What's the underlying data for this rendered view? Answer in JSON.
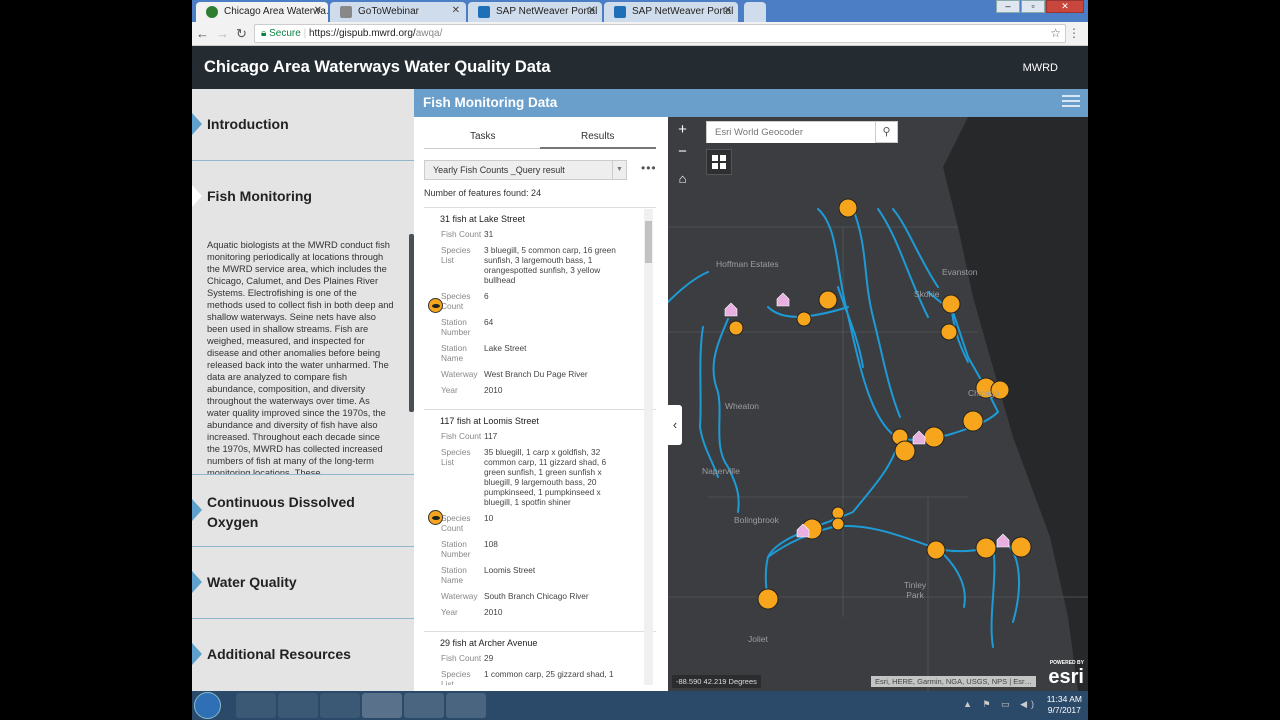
{
  "browser": {
    "tabs": [
      {
        "title": "Chicago Area Waterwa…",
        "active": true,
        "icon": "globe-icon"
      },
      {
        "title": "GoToWebinar",
        "active": false,
        "icon": "webinar-icon"
      },
      {
        "title": "SAP NetWeaver Portal",
        "active": false,
        "icon": "sap-icon"
      },
      {
        "title": "SAP NetWeaver Portal",
        "active": false,
        "icon": "sap-icon"
      }
    ],
    "secure_label": "Secure",
    "url_host": "https://gispub.mwrd.org/",
    "url_path": "awqa/"
  },
  "app": {
    "title": "Chicago Area Waterways Water Quality Data",
    "org": "MWRD"
  },
  "nav": {
    "items": [
      {
        "label": "Introduction"
      },
      {
        "label": "Fish Monitoring"
      },
      {
        "label": "Continuous Dissolved\nOxygen"
      },
      {
        "label": "Water Quality"
      },
      {
        "label": "Additional Resources"
      }
    ],
    "fish_text": "Aquatic biologists at the MWRD conduct fish monitoring periodically at locations through the MWRD service area, which includes the Chicago, Calumet, and Des Plaines River Systems. Electrofishing is one of the methods used to collect fish in both deep and shallow waterways. Seine nets have also been used in shallow streams. Fish are weighed, measured, and inspected for disease and other anomalies before being released back into the water unharmed. The data are analyzed to compare fish abundance, composition, and diversity throughout the waterways over time. As water quality improved since the 1970s, the abundance and diversity of fish have also increased. Throughout each decade since the 1970s, MWRD has collected increased numbers of fish at many of the long-term monitoring locations. These"
  },
  "panel": {
    "title": "Fish Monitoring Data",
    "tab_tasks": "Tasks",
    "tab_results": "Results",
    "query_select": "Yearly Fish Counts _Query result",
    "more": "•••",
    "feature_count": "Number of features found: 24",
    "results": [
      {
        "title": "31 fish at Lake Street",
        "fields": [
          {
            "name": "Fish Count",
            "value": "31"
          },
          {
            "name": "Species List",
            "value": "3 bluegill, 5 common carp, 16 green sunfish, 3 largemouth bass, 1 orangespotted sunfish, 3 yellow bullhead"
          },
          {
            "name": "Species Count",
            "value": "6"
          },
          {
            "name": "Station Number",
            "value": "64"
          },
          {
            "name": "Station Name",
            "value": "Lake Street"
          },
          {
            "name": "Waterway",
            "value": "West Branch Du Page River"
          },
          {
            "name": "Year",
            "value": "2010"
          }
        ]
      },
      {
        "title": "117 fish at Loomis Street",
        "fields": [
          {
            "name": "Fish Count",
            "value": "117"
          },
          {
            "name": "Species List",
            "value": "35 bluegill, 1 carp x goldfish, 32 common carp, 11 gizzard shad, 6 green sunfish, 1 green sunfish x bluegill, 9 largemouth bass, 20 pumpkinseed, 1 pumpkinseed x bluegill, 1 spotfin shiner"
          },
          {
            "name": "Species Count",
            "value": "10"
          },
          {
            "name": "Station Number",
            "value": "108"
          },
          {
            "name": "Station Name",
            "value": "Loomis Street"
          },
          {
            "name": "Waterway",
            "value": "South Branch Chicago River"
          },
          {
            "name": "Year",
            "value": "2010"
          }
        ]
      },
      {
        "title": "29 fish at Archer Avenue",
        "fields": [
          {
            "name": "Fish Count",
            "value": "29"
          },
          {
            "name": "Species List",
            "value": "1 common carp, 25 gizzard shad, 1"
          }
        ]
      }
    ]
  },
  "map": {
    "search_placeholder": "Esri World Geocoder",
    "places": [
      "Hoffman Estates",
      "Evanston",
      "Skokie",
      "Chicago",
      "Wheaton",
      "Naperville",
      "Bolingbrook",
      "Tinley Park",
      "Joliet"
    ],
    "coords": "-88.590 42.219 Degrees",
    "attribution": "Esri, HERE, Garmin, NGA, USGS, NPS | Esr…",
    "esri_powered": "POWERED BY",
    "esri_logo": "esri",
    "colors": {
      "river": "#1e9bd7",
      "fish_marker": "#f6a51c",
      "basemap": "#3b3d40"
    }
  },
  "taskbar": {
    "time": "11:34 AM",
    "date": "9/7/2017"
  }
}
